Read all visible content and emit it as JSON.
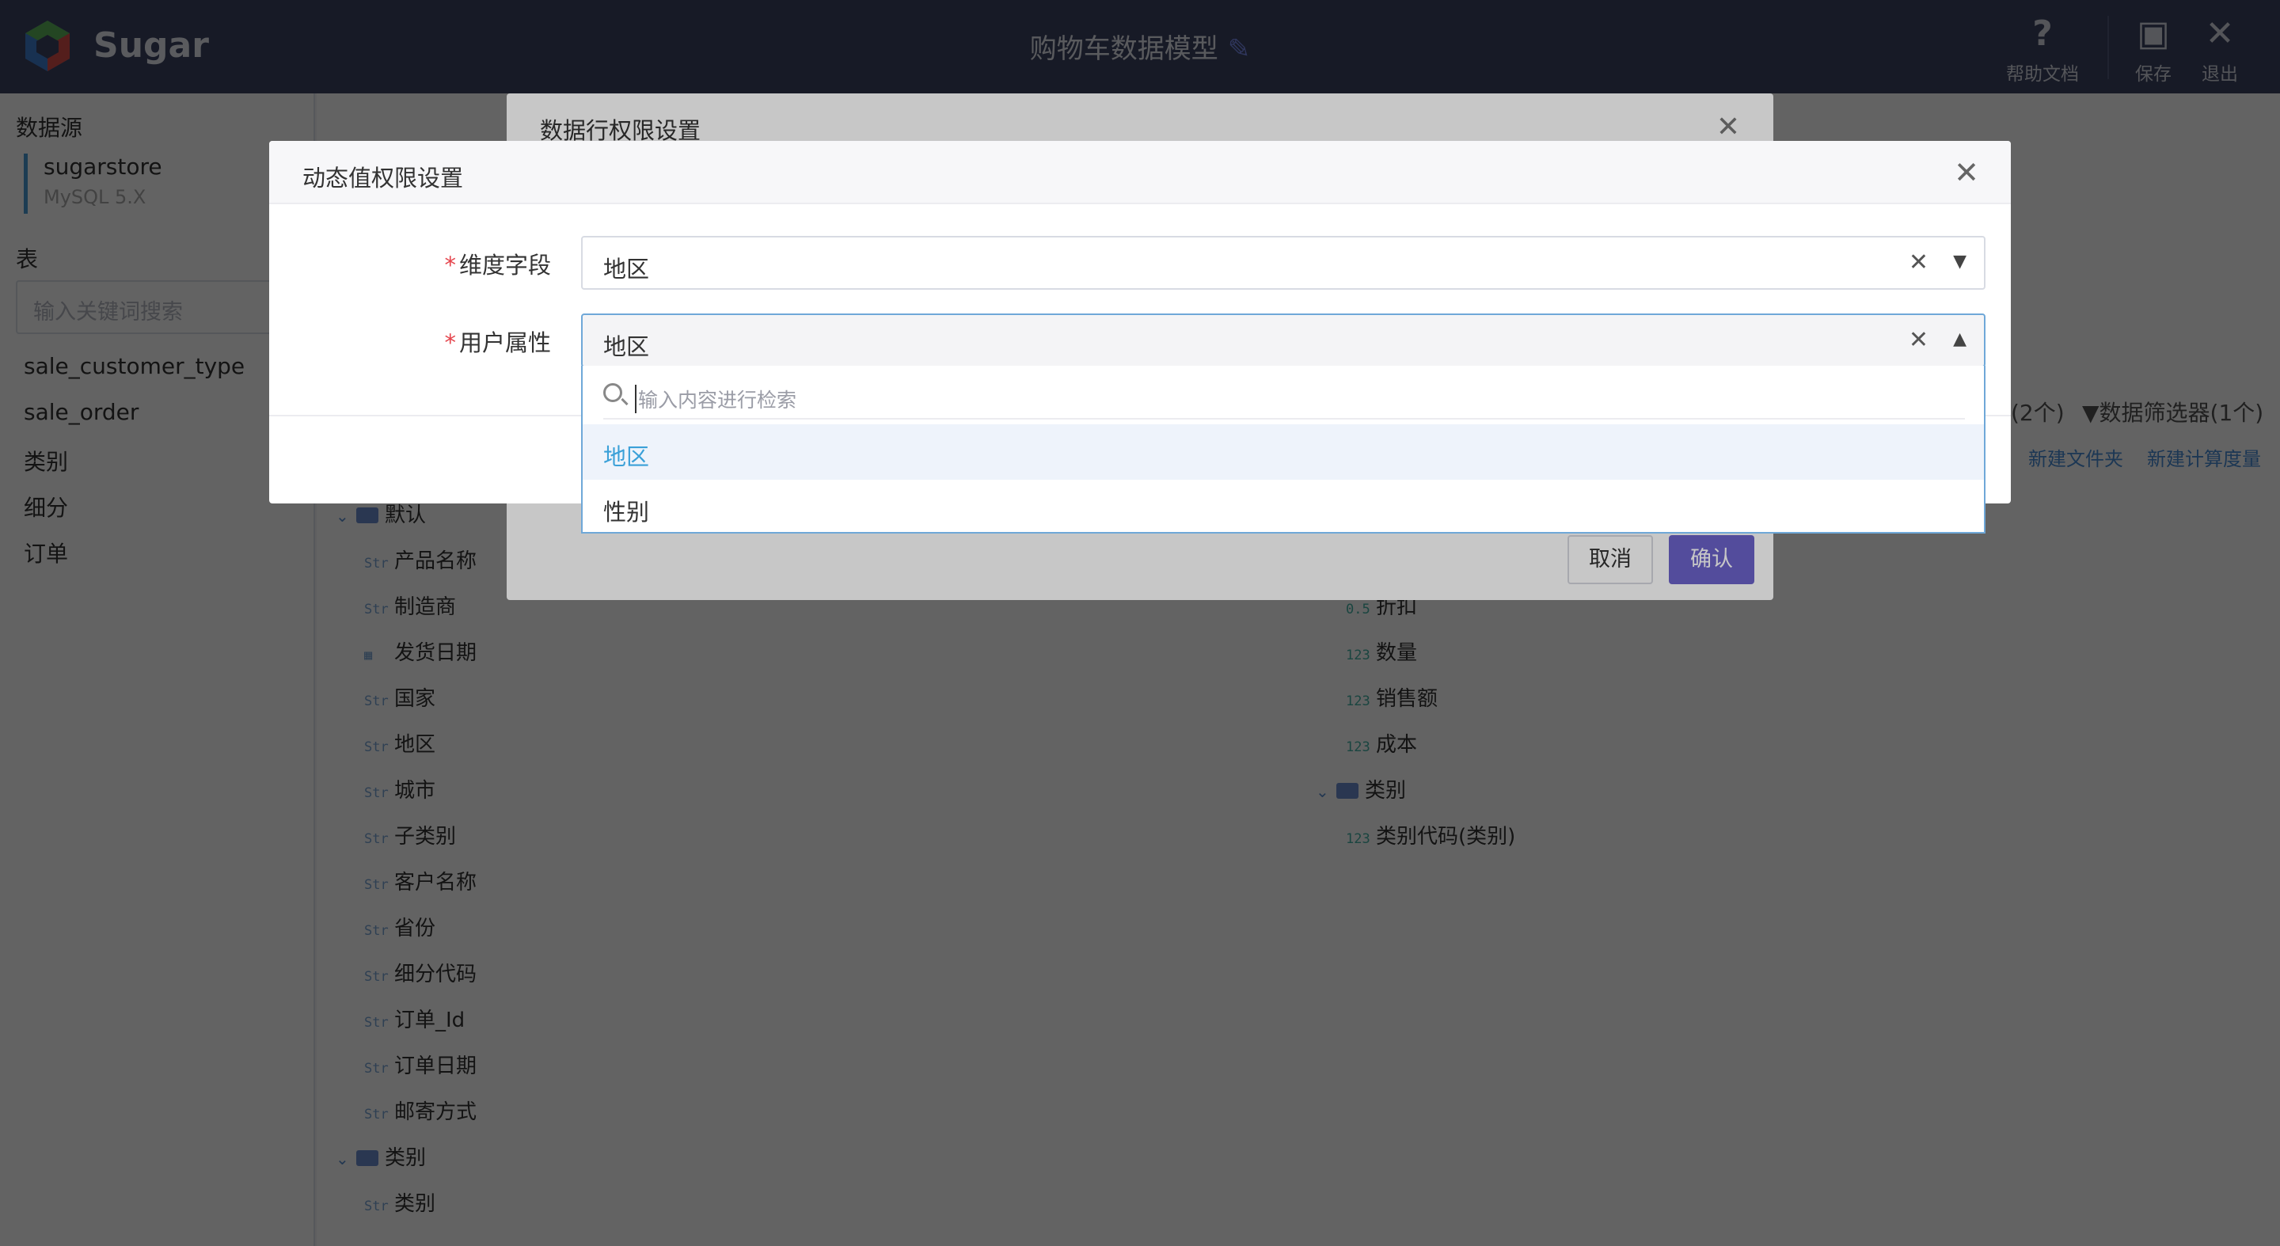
{
  "topbar": {
    "brand": "Sugar",
    "title": "购物车数据模型",
    "help_label": "帮助文档",
    "save_label": "保存",
    "exit_label": "退出"
  },
  "sidebar": {
    "datasource_heading": "数据源",
    "datasource": {
      "name": "sugarstore",
      "version": "MySQL 5.X"
    },
    "table_heading": "表",
    "search_placeholder": "输入关键词搜索",
    "tables": [
      "sale_customer_type",
      "sale_order",
      "类别",
      "细分",
      "订单"
    ]
  },
  "main": {
    "filter_summary": "(2个)",
    "filter_label": "数据筛选器(1个)",
    "new_folder": "新建文件夹",
    "new_measure": "新建计算度量",
    "dimensions": {
      "folder_default": "默认",
      "fields": [
        {
          "type": "Str",
          "name": "产品名称"
        },
        {
          "type": "Str",
          "name": "制造商"
        },
        {
          "type": "date",
          "name": "发货日期"
        },
        {
          "type": "Str",
          "name": "国家"
        },
        {
          "type": "Str",
          "name": "地区"
        },
        {
          "type": "Str",
          "name": "城市"
        },
        {
          "type": "Str",
          "name": "子类别"
        },
        {
          "type": "Str",
          "name": "客户名称"
        },
        {
          "type": "Str",
          "name": "省份"
        },
        {
          "type": "Str",
          "name": "细分代码"
        },
        {
          "type": "Str",
          "name": "订单_Id"
        },
        {
          "type": "Str",
          "name": "订单日期"
        },
        {
          "type": "Str",
          "name": "邮寄方式"
        }
      ],
      "folder_category": "类别",
      "category_fields": [
        {
          "type": "Str",
          "name": "类别"
        }
      ]
    },
    "measures": {
      "fields": [
        {
          "type": "0.5",
          "name": "折扣"
        },
        {
          "type": "123",
          "name": "数量"
        },
        {
          "type": "123",
          "name": "销售额"
        },
        {
          "type": "123",
          "name": "成本"
        }
      ],
      "folder_category": "类别",
      "category_fields": [
        {
          "type": "123",
          "name": "类别代码(类别)"
        }
      ]
    }
  },
  "row_permission_dialog": {
    "title": "数据行权限设置",
    "cancel_label": "取消",
    "confirm_label": "确认"
  },
  "dynamic_dialog": {
    "title": "动态值权限设置",
    "dimension_label": "维度字段",
    "dimension_value": "地区",
    "attribute_label": "用户属性",
    "attribute_value": "地区",
    "required_mark": "*",
    "dropdown": {
      "search_placeholder": "输入内容进行检索",
      "options": [
        "地区",
        "性别"
      ],
      "selected": "地区"
    }
  },
  "colors": {
    "topbar": "#3d4463",
    "primary": "#6b62c8",
    "link": "#4a8ed8",
    "selected_option": "#3aa0d8",
    "required": "#e5454d"
  }
}
